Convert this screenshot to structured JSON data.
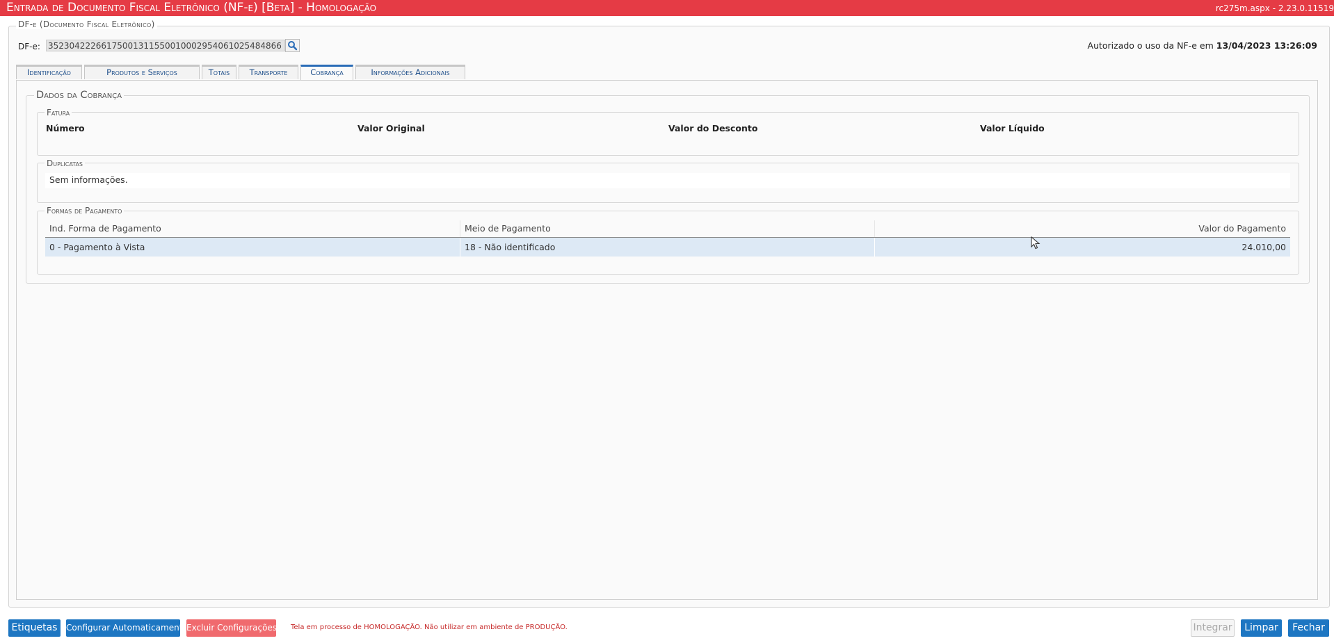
{
  "window": {
    "title": "Entrada de Documento Fiscal Eletrônico (NF-e) [Beta]  - Homologação",
    "version": "rc275m.aspx - 2.23.0.11519"
  },
  "document": {
    "legend": "DF-e (Documento Fiscal Eletrônico)",
    "dfe_label": "DF-e:",
    "dfe_value": "35230422266175001311550010002954061025484866",
    "auth_text": "Autorizado o uso da NF-e em",
    "auth_date": "13/04/2023 13:26:09"
  },
  "tabs": [
    {
      "label": "Identificação"
    },
    {
      "label": "Produtos e Serviços"
    },
    {
      "label": "Totais"
    },
    {
      "label": "Transporte"
    },
    {
      "label": "Cobrança"
    },
    {
      "label": "Informações Adicionais"
    }
  ],
  "cobranca": {
    "legend": "Dados da Cobrança",
    "fatura": {
      "legend": "Fatura",
      "headers": [
        "Número",
        "Valor Original",
        "Valor do Desconto",
        "Valor Líquido"
      ]
    },
    "duplicatas": {
      "legend": "Duplicatas",
      "empty_text": "Sem informações."
    },
    "pagamento": {
      "legend": "Formas de Pagamento",
      "headers": [
        "Ind. Forma de Pagamento",
        "Meio de Pagamento",
        "Valor do Pagamento"
      ],
      "rows": [
        [
          "0 - Pagamento à Vista",
          "18 - Não identificado",
          "24.010,00"
        ]
      ]
    }
  },
  "footer": {
    "etiquetas": "Etiquetas",
    "configurar": "Configurar Automaticamente",
    "excluir": "Excluir Configurações",
    "warning": "Tela em processo de HOMOLOGAÇÃO. Não utilizar em ambiente de PRODUÇÃO.",
    "integrar": "Integrar",
    "limpar": "Limpar",
    "fechar": "Fechar"
  },
  "colors": {
    "title_bar": "#e53b45",
    "primary_button": "#1d76c2",
    "danger_button": "#f06a6e",
    "selected_row": "#dde9f5"
  }
}
